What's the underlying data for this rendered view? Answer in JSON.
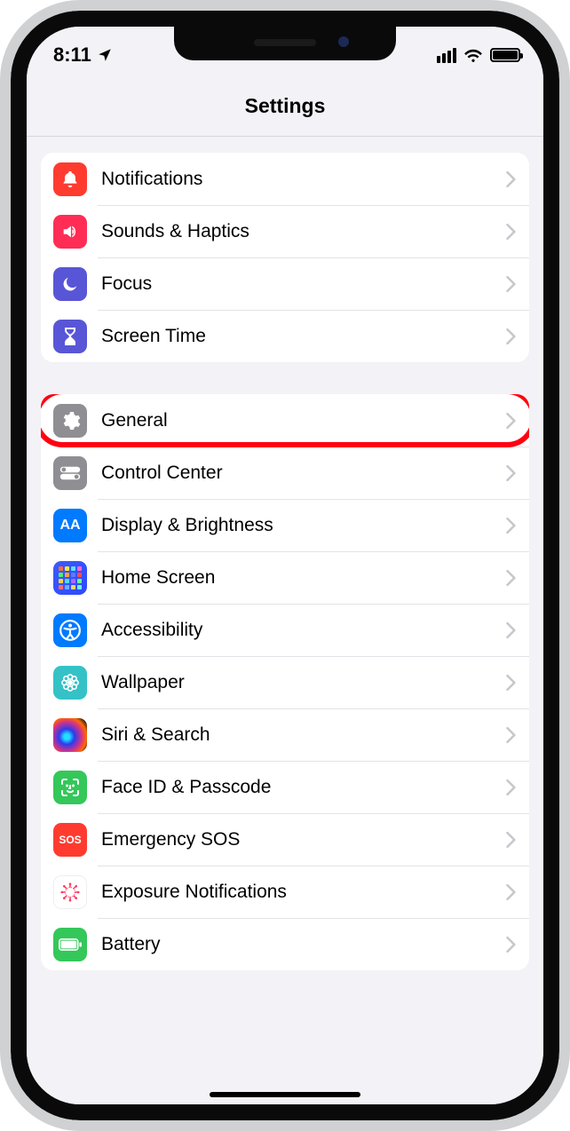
{
  "status": {
    "time": "8:11",
    "location_icon": "location-arrow-icon",
    "cellular": "4-bars",
    "wifi": "wifi-icon",
    "battery": "full"
  },
  "header": {
    "title": "Settings"
  },
  "groups": [
    {
      "id": "group-notify",
      "items": [
        {
          "key": "notifications",
          "label": "Notifications",
          "icon": "bell-icon",
          "icon_bg": "bg-red"
        },
        {
          "key": "sounds",
          "label": "Sounds & Haptics",
          "icon": "speaker-icon",
          "icon_bg": "bg-pink"
        },
        {
          "key": "focus",
          "label": "Focus",
          "icon": "moon-icon",
          "icon_bg": "bg-indigo"
        },
        {
          "key": "screentime",
          "label": "Screen Time",
          "icon": "hourglass-icon",
          "icon_bg": "bg-indigo"
        }
      ]
    },
    {
      "id": "group-general",
      "items": [
        {
          "key": "general",
          "label": "General",
          "icon": "gear-icon",
          "icon_bg": "bg-gray",
          "highlighted": true
        },
        {
          "key": "controlcenter",
          "label": "Control Center",
          "icon": "toggles-icon",
          "icon_bg": "bg-gray"
        },
        {
          "key": "display",
          "label": "Display & Brightness",
          "icon": "aa-icon",
          "icon_bg": "bg-blue"
        },
        {
          "key": "homescreen",
          "label": "Home Screen",
          "icon": "home-grid-icon",
          "icon_bg": "bg-home"
        },
        {
          "key": "accessibility",
          "label": "Accessibility",
          "icon": "accessibility-icon",
          "icon_bg": "bg-blue"
        },
        {
          "key": "wallpaper",
          "label": "Wallpaper",
          "icon": "flower-icon",
          "icon_bg": "bg-teal"
        },
        {
          "key": "siri",
          "label": "Siri & Search",
          "icon": "siri-icon",
          "icon_bg": "bg-siri"
        },
        {
          "key": "faceid",
          "label": "Face ID & Passcode",
          "icon": "faceid-icon",
          "icon_bg": "bg-green"
        },
        {
          "key": "sos",
          "label": "Emergency SOS",
          "icon": "sos-icon",
          "icon_bg": "bg-sos",
          "icon_text": "SOS"
        },
        {
          "key": "exposure",
          "label": "Exposure Notifications",
          "icon": "covid-icon",
          "icon_bg": "bg-white"
        },
        {
          "key": "battery",
          "label": "Battery",
          "icon": "battery-icon",
          "icon_bg": "bg-green"
        }
      ]
    }
  ],
  "annotation": {
    "highlight_target": "general",
    "highlight_color": "#ff0012"
  }
}
